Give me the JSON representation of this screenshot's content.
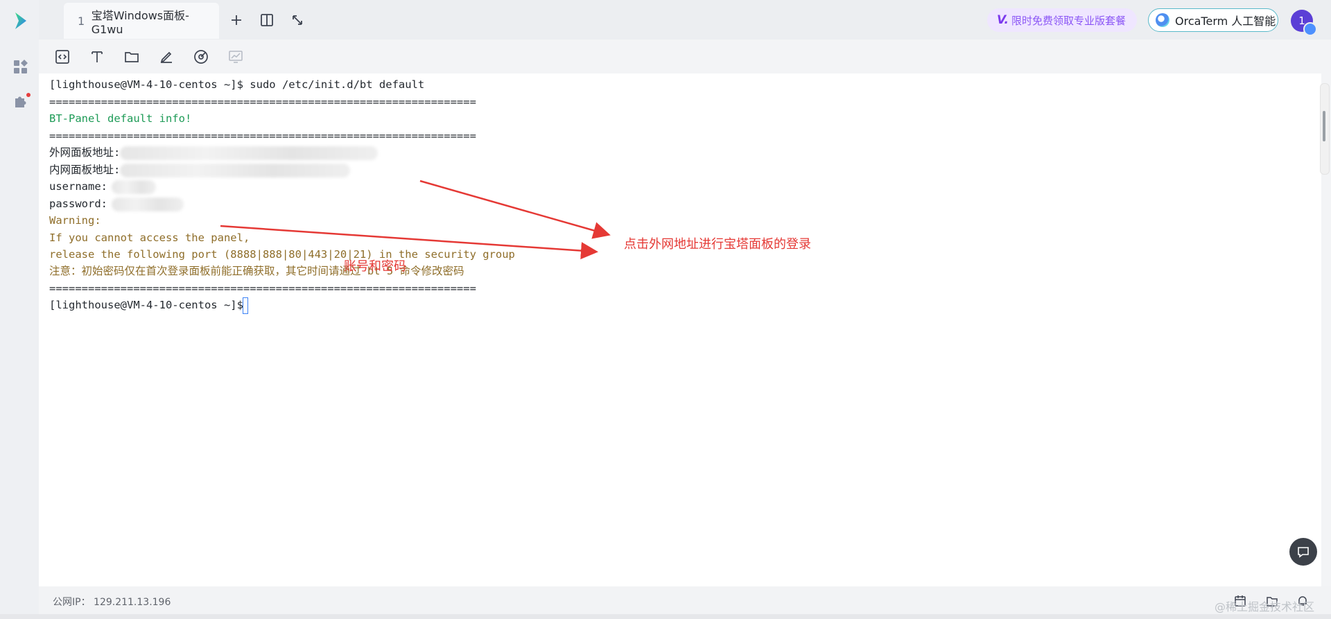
{
  "tab": {
    "index": "1",
    "title": "宝塔Windows面板-G1wu"
  },
  "header": {
    "promo_label": "限时免费领取专业版套餐",
    "ai_button_label": "OrcaTerm 人工智能",
    "avatar_label": "1"
  },
  "terminal": {
    "lines": [
      "[lighthouse@VM-4-10-centos ~]$ sudo /etc/init.d/bt default",
      "==================================================================",
      "BT-Panel default info!",
      "==================================================================",
      "外网面板地址:",
      "内网面板地址:",
      "username:",
      "password:",
      "Warning:",
      "If you cannot access the panel,",
      "release the following port (8888|888|80|443|20|21) in the security group",
      "注意：初始密码仅在首次登录面板前能正确获取，其它时间请通过 bt 5 命令修改密码",
      "==================================================================",
      "[lighthouse@VM-4-10-centos ~]$"
    ],
    "colors": {
      "green": "#1e9b57",
      "brown": "#8f6e2a",
      "default": "#24292f"
    }
  },
  "annotations": {
    "login_note": "点击外网地址进行宝塔面板的登录",
    "account_note": "账号和密码",
    "color": "#e53935"
  },
  "statusbar": {
    "ip_label": "公网IP：",
    "ip_value": "129.211.13.196"
  },
  "watermark": "@稀土掘金技术社区",
  "icons": {
    "rail": [
      "logo-icon",
      "apps-icon",
      "plugin-icon"
    ],
    "topbar": [
      "add-tab-icon",
      "split-view-icon",
      "fullscreen-icon"
    ],
    "toolbar": [
      "code-icon",
      "text-icon",
      "folder-icon",
      "edit-icon",
      "monitor-icon",
      "chart-icon"
    ],
    "status": [
      "calendar-icon",
      "folder-upload-icon",
      "bell-icon"
    ]
  }
}
